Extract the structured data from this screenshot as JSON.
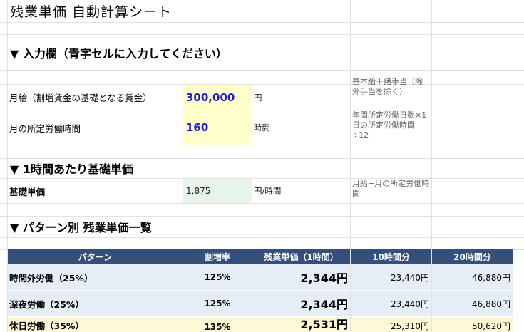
{
  "title": "残業単価 自動計算シート",
  "input_section": {
    "heading": "▼ 入力欄（青字セルに入力してください）",
    "rows": [
      {
        "label": "月給（割増賃金の基礎となる賃金）",
        "value": "300,000",
        "unit": "円",
        "note": "基本給＋諸手当（除外手当を除く）"
      },
      {
        "label": "月の所定労働時間",
        "value": "160",
        "unit": "時間",
        "note": "年間所定労働日数×1日の所定労働時間÷12"
      }
    ]
  },
  "base_section": {
    "heading": "▼ 1時間あたり基礎単価",
    "label": "基礎単価",
    "value": "1,875",
    "unit": "円/時間",
    "note": "月給÷月の所定労働時間"
  },
  "pattern_section": {
    "heading": "▼ パターン別 残業単価一覧",
    "columns": [
      "パターン",
      "割増率",
      "残業単価（1時間）",
      "10時間分",
      "20時間分"
    ],
    "rows": [
      {
        "name": "時間外労働（25%）",
        "rate": "125%",
        "unit_price": "2,344円",
        "h10": "23,440円",
        "h20": "46,880円"
      },
      {
        "name": "深夜労働（25%）",
        "rate": "125%",
        "unit_price": "2,344円",
        "h10": "23,440円",
        "h20": "46,880円"
      },
      {
        "name": "休日労働（35%）",
        "rate": "135%",
        "unit_price": "2,531円",
        "h10": "25,310円",
        "h20": "50,620円"
      }
    ]
  }
}
